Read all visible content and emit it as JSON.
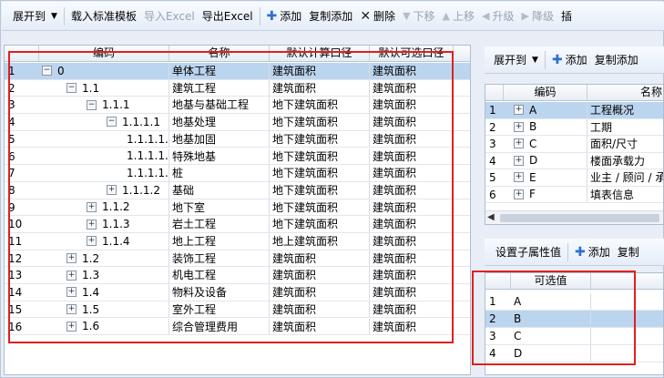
{
  "toolbar": {
    "expand_label": "展开到",
    "load_template_label": "载入标准模板",
    "import_excel_label": "导入Excel",
    "export_excel_label": "导出Excel",
    "add_label": "添加",
    "copy_add_label": "复制添加",
    "delete_label": "删除",
    "move_down_label": "下移",
    "move_up_label": "上移",
    "promote_label": "升级",
    "demote_label": "降级",
    "truncated_label": "插"
  },
  "left_grid": {
    "columns": [
      "编码",
      "名称",
      "默认计算口径",
      "默认可选口径"
    ],
    "rows": [
      {
        "num": "1",
        "code": "0",
        "name": "单体工程",
        "calc": "建筑面积",
        "opt": "建筑面积",
        "level": 0,
        "exp": "−"
      },
      {
        "num": "2",
        "code": "1.1",
        "name": "建筑工程",
        "calc": "建筑面积",
        "opt": "建筑面积",
        "level": 1,
        "exp": "−"
      },
      {
        "num": "3",
        "code": "1.1.1",
        "name": "地基与基础工程",
        "calc": "地下建筑面积",
        "opt": "建筑面积",
        "level": 2,
        "exp": "−"
      },
      {
        "num": "4",
        "code": "1.1.1.1",
        "name": "地基处理",
        "calc": "地下建筑面积",
        "opt": "建筑面积",
        "level": 3,
        "exp": "−"
      },
      {
        "num": "5",
        "code": "1.1.1.1.1",
        "name": "地基加固",
        "calc": "地下建筑面积",
        "opt": "建筑面积",
        "level": 4,
        "exp": ""
      },
      {
        "num": "6",
        "code": "1.1.1.1.2",
        "name": "特殊地基",
        "calc": "地下建筑面积",
        "opt": "建筑面积",
        "level": 4,
        "exp": ""
      },
      {
        "num": "7",
        "code": "1.1.1.1.3",
        "name": "桩",
        "calc": "地下建筑面积",
        "opt": "建筑面积",
        "level": 4,
        "exp": ""
      },
      {
        "num": "8",
        "code": "1.1.1.2",
        "name": "基础",
        "calc": "地下建筑面积",
        "opt": "建筑面积",
        "level": 3,
        "exp": "+"
      },
      {
        "num": "9",
        "code": "1.1.2",
        "name": "地下室",
        "calc": "地下建筑面积",
        "opt": "建筑面积",
        "level": 2,
        "exp": "+"
      },
      {
        "num": "10",
        "code": "1.1.3",
        "name": "岩土工程",
        "calc": "地下建筑面积",
        "opt": "建筑面积",
        "level": 2,
        "exp": "+"
      },
      {
        "num": "11",
        "code": "1.1.4",
        "name": "地上工程",
        "calc": "地上建筑面积",
        "opt": "建筑面积",
        "level": 2,
        "exp": "+"
      },
      {
        "num": "12",
        "code": "1.2",
        "name": "装饰工程",
        "calc": "建筑面积",
        "opt": "建筑面积",
        "level": 1,
        "exp": "+"
      },
      {
        "num": "13",
        "code": "1.3",
        "name": "机电工程",
        "calc": "建筑面积",
        "opt": "建筑面积",
        "level": 1,
        "exp": "+"
      },
      {
        "num": "14",
        "code": "1.4",
        "name": "物料及设备",
        "calc": "建筑面积",
        "opt": "建筑面积",
        "level": 1,
        "exp": "+"
      },
      {
        "num": "15",
        "code": "1.5",
        "name": "室外工程",
        "calc": "建筑面积",
        "opt": "建筑面积",
        "level": 1,
        "exp": "+"
      },
      {
        "num": "16",
        "code": "1.6",
        "name": "综合管理费用",
        "calc": "建筑面积",
        "opt": "建筑面积",
        "level": 1,
        "exp": "+"
      }
    ]
  },
  "right_toolbar": {
    "expand_label": "展开到",
    "add_label": "添加",
    "copy_add_label": "复制添加"
  },
  "right_grid": {
    "columns": [
      "编码",
      "名称"
    ],
    "rows": [
      {
        "num": "1",
        "code": "A",
        "name": "工程概况"
      },
      {
        "num": "2",
        "code": "B",
        "name": "工期"
      },
      {
        "num": "3",
        "code": "C",
        "name": "面积/尺寸"
      },
      {
        "num": "4",
        "code": "D",
        "name": "楼面承载力"
      },
      {
        "num": "5",
        "code": "E",
        "name": "业主 / 顾问 / 承"
      },
      {
        "num": "6",
        "code": "F",
        "name": "填表信息"
      }
    ]
  },
  "sub_toolbar": {
    "set_child_label": "设置子属性值",
    "add_label": "添加",
    "copy_label": "复制"
  },
  "options_grid": {
    "column": "可选值",
    "rows": [
      {
        "num": "1",
        "value": "A"
      },
      {
        "num": "2",
        "value": "B"
      },
      {
        "num": "3",
        "value": "C"
      },
      {
        "num": "4",
        "value": "D"
      }
    ]
  },
  "colors": {
    "accent_blue": "#2d6fd4",
    "selection": "#bcd5ef",
    "annotation_red": "#e02020"
  }
}
